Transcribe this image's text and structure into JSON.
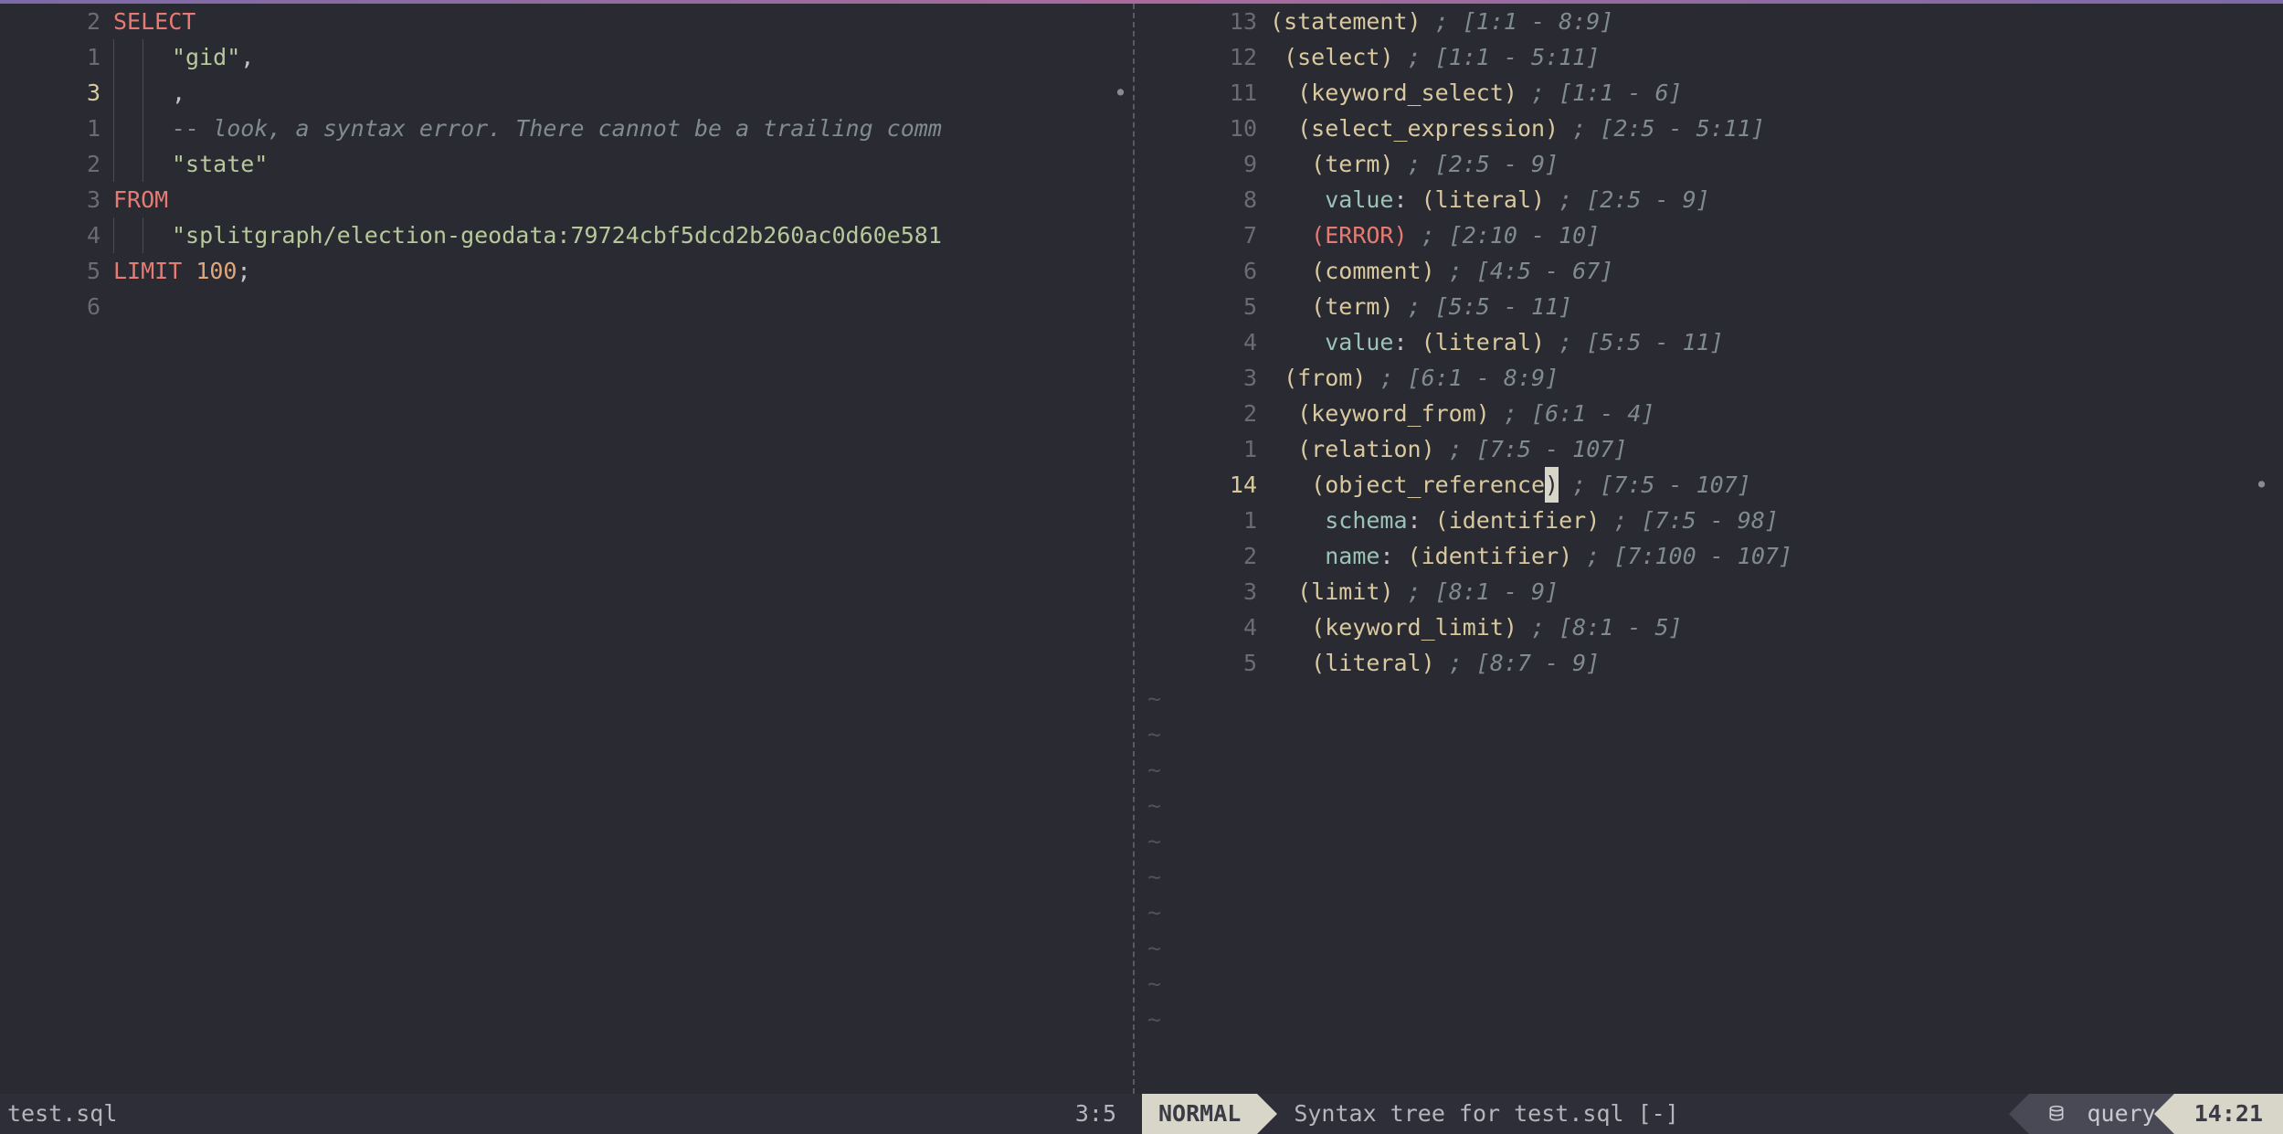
{
  "left_pane": {
    "filename": "test.sql",
    "cursor_pos": "3:5",
    "active_row_index": 2,
    "lines": [
      {
        "num": "2",
        "tokens": [
          {
            "t": "SELECT",
            "c": "kw"
          }
        ]
      },
      {
        "num": "1",
        "tokens": [
          {
            "t": "  ",
            "c": "indent"
          },
          {
            "t": "  ",
            "c": "indent"
          },
          {
            "t": "\"gid\"",
            "c": "str"
          },
          {
            "t": ",",
            "c": "plain"
          }
        ]
      },
      {
        "num": "3",
        "active": true,
        "tokens": [
          {
            "t": "  ",
            "c": "indent"
          },
          {
            "t": "  ",
            "c": "indent"
          },
          {
            "t": ",",
            "c": "plain"
          }
        ]
      },
      {
        "num": "1",
        "tokens": [
          {
            "t": "  ",
            "c": "indent"
          },
          {
            "t": "  ",
            "c": "indent"
          },
          {
            "t": "-- look, a syntax error. There cannot be a trailing comm",
            "c": "comment"
          }
        ]
      },
      {
        "num": "2",
        "tokens": [
          {
            "t": "  ",
            "c": "indent"
          },
          {
            "t": "  ",
            "c": "indent"
          },
          {
            "t": "\"state\"",
            "c": "str"
          }
        ]
      },
      {
        "num": "3",
        "tokens": [
          {
            "t": "FROM",
            "c": "kw"
          }
        ]
      },
      {
        "num": "4",
        "tokens": [
          {
            "t": "  ",
            "c": "indent"
          },
          {
            "t": "  ",
            "c": "indent"
          },
          {
            "t": "\"splitgraph/election-geodata:79724cbf5dcd2b260ac0d60e581",
            "c": "str"
          }
        ]
      },
      {
        "num": "5",
        "tokens": [
          {
            "t": "LIMIT",
            "c": "kw"
          },
          {
            "t": " ",
            "c": "plain"
          },
          {
            "t": "100",
            "c": "num"
          },
          {
            "t": ";",
            "c": "plain"
          }
        ]
      },
      {
        "num": "6",
        "tokens": []
      }
    ]
  },
  "right_pane": {
    "title": "Syntax tree for test.sql [-]",
    "active_row_index": 13,
    "tilde_count": 10,
    "lines": [
      {
        "num": "13",
        "indent": 0,
        "pre": "(",
        "node": "statement",
        "post": ")",
        "annot": " ; [1:1 - 8:9]"
      },
      {
        "num": "12",
        "indent": 1,
        "pre": "(",
        "node": "select",
        "post": ")",
        "annot": " ; [1:1 - 5:11]"
      },
      {
        "num": "11",
        "indent": 2,
        "pre": "(",
        "node": "keyword_select",
        "post": ")",
        "annot": " ; [1:1 - 6]"
      },
      {
        "num": "10",
        "indent": 2,
        "pre": "(",
        "node": "select_expression",
        "post": ")",
        "annot": " ; [2:5 - 5:11]"
      },
      {
        "num": "9",
        "indent": 3,
        "pre": "(",
        "node": "term",
        "post": ")",
        "annot": " ; [2:5 - 9]"
      },
      {
        "num": "8",
        "indent": 4,
        "field": "value",
        "pre": "(",
        "node": "literal",
        "post": ")",
        "annot": " ; [2:5 - 9]"
      },
      {
        "num": "7",
        "indent": 3,
        "pre": "(",
        "node": "ERROR",
        "post": ")",
        "err": true,
        "annot": " ; [2:10 - 10]"
      },
      {
        "num": "6",
        "indent": 3,
        "pre": "(",
        "node": "comment",
        "post": ")",
        "annot": " ; [4:5 - 67]"
      },
      {
        "num": "5",
        "indent": 3,
        "pre": "(",
        "node": "term",
        "post": ")",
        "annot": " ; [5:5 - 11]"
      },
      {
        "num": "4",
        "indent": 4,
        "field": "value",
        "pre": "(",
        "node": "literal",
        "post": ")",
        "annot": " ; [5:5 - 11]"
      },
      {
        "num": "3",
        "indent": 1,
        "pre": "(",
        "node": "from",
        "post": ")",
        "annot": " ; [6:1 - 8:9]"
      },
      {
        "num": "2",
        "indent": 2,
        "pre": "(",
        "node": "keyword_from",
        "post": ")",
        "annot": " ; [6:1 - 4]"
      },
      {
        "num": "1",
        "indent": 2,
        "pre": "(",
        "node": "relation",
        "post": ")",
        "annot": " ; [7:5 - 107]"
      },
      {
        "num": "14",
        "active": true,
        "indent": 3,
        "pre": "(",
        "node": "object_reference",
        "post_cursor": ")",
        "annot": " ; [7:5 - 107]"
      },
      {
        "num": "1",
        "indent": 4,
        "field": "schema",
        "pre": "(",
        "node": "identifier",
        "post": ")",
        "annot": " ; [7:5 - 98]"
      },
      {
        "num": "2",
        "indent": 4,
        "field": "name",
        "pre": "(",
        "node": "identifier",
        "post": ")",
        "annot": " ; [7:100 - 107]"
      },
      {
        "num": "3",
        "indent": 2,
        "pre": "(",
        "node": "limit",
        "post": ")",
        "annot": " ; [8:1 - 9]"
      },
      {
        "num": "4",
        "indent": 3,
        "pre": "(",
        "node": "keyword_limit",
        "post": ")",
        "annot": " ; [8:1 - 5]"
      },
      {
        "num": "5",
        "indent": 3,
        "pre": "(",
        "node": "literal",
        "post": ")",
        "annot": " ; [8:7 - 9]"
      }
    ]
  },
  "status": {
    "mode": "NORMAL",
    "db_label": "query",
    "clock": "14:21"
  }
}
